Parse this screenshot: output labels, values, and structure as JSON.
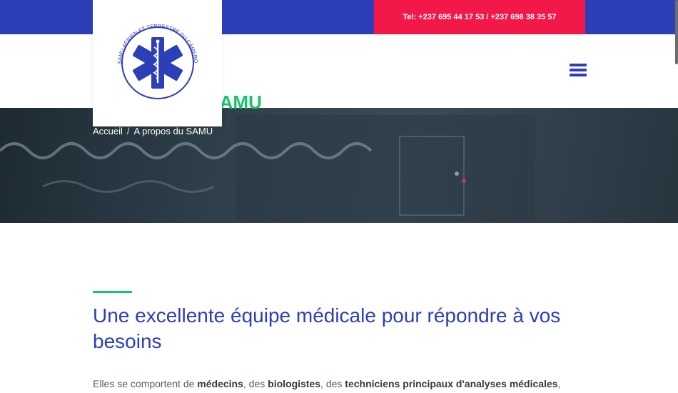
{
  "header": {
    "phone_text": "Tel: +237 695 44 17 53 / +237 698 38 35 57",
    "logo_ring_text": "SAMU AÉRIEN ET TERRESTRE DU CAMEROUN",
    "menu_icon": "hamburger-menu-icon"
  },
  "hero": {
    "title": "À propos du SAMU",
    "breadcrumb": {
      "home": "Accueil",
      "separator": "/",
      "current": "A propos du SAMU"
    }
  },
  "main": {
    "headline": "Une excellente équipe médicale pour répondre à vos besoins",
    "intro": {
      "t1": "Elles se comportent de ",
      "b1": "médecins",
      "t2": ", des ",
      "b2": "biologistes",
      "t3": ", des ",
      "b3": "techniciens principaux d'analyses médicales",
      "t4": ","
    }
  },
  "colors": {
    "brand_blue": "#2c3fb8",
    "accent_red": "#f2194a",
    "accent_green": "#19c36e"
  }
}
